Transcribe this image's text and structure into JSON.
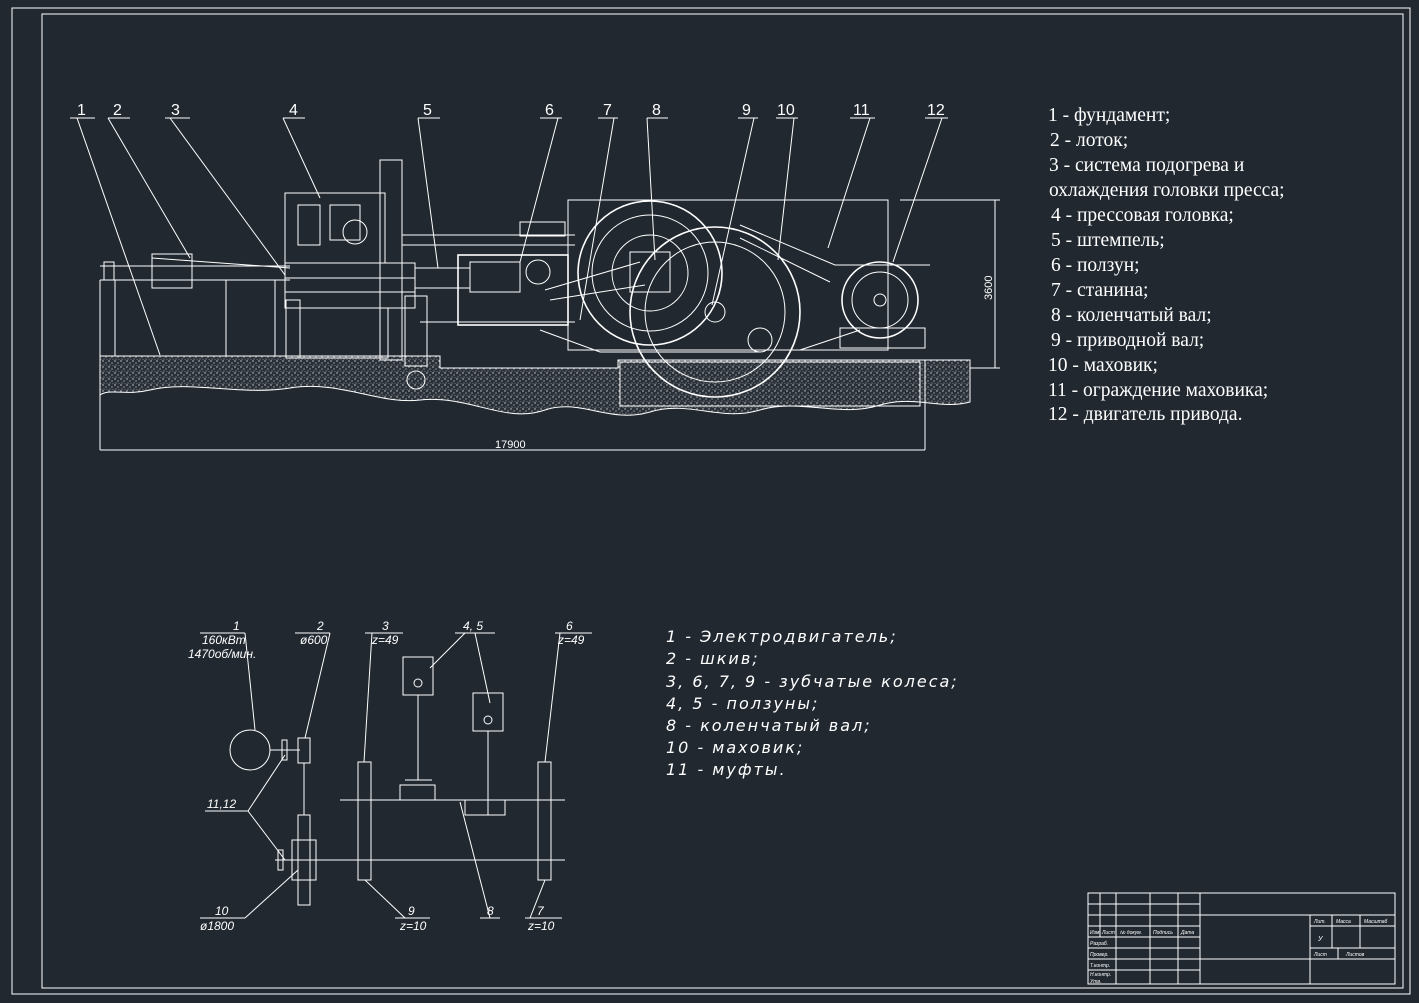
{
  "drawing": {
    "upper_view": {
      "callouts": [
        "1",
        "2",
        "3",
        "4",
        "5",
        "6",
        "7",
        "8",
        "9",
        "10",
        "11",
        "12"
      ],
      "dim_length": "17900",
      "dim_height": "3600",
      "legend": [
        "1 - фундамент;",
        "2 - лоток;",
        "3 - система подогрева и",
        "охлаждения головки пресса;",
        "4 - прессовая головка;",
        "5 - штемпель;",
        "6 - ползун;",
        "7 - станина;",
        "8 - коленчатый вал;",
        "9 - приводной вал;",
        "10 - маховик;",
        "11 - ограждение маховика;",
        "12 - двигатель привода."
      ]
    },
    "kinematic": {
      "label_1": "1",
      "label_1_power": "160кВт",
      "label_1_speed": "1470об/мин.",
      "label_2": "2",
      "label_2_dia": "ø600",
      "label_3": "3",
      "label_3_z": "z=49",
      "label_45": "4, 5",
      "label_6": "6",
      "label_6_z": "z=49",
      "label_1112": "11,12",
      "label_10": "10",
      "label_10_dia": "ø1800",
      "label_9": "9",
      "label_9_z": "z=10",
      "label_8": "8",
      "label_7": "7",
      "label_7_z": "z=10",
      "legend": [
        "1 - Электродвигатель;",
        "2 - шкив;",
        "3, 6, 7, 9 - зубчатые колеса;",
        "4, 5 -  ползуны;",
        "8 - коленчатый вал;",
        "10 - маховик;",
        "11 - муфты."
      ]
    },
    "title_block": {
      "h_izm": "Изм.",
      "h_list": "Лист",
      "h_doc": "№ докум.",
      "h_sign": "Подпись",
      "h_date": "Дата",
      "r_razrab": "Разраб.",
      "r_prov": "Провер.",
      "r_tkontr": "Т.контр.",
      "r_nkontr": "Н.контр.",
      "r_utv": "Утв.",
      "lit": "Лит.",
      "massa": "Масса",
      "masshtab": "Масштаб",
      "lit_val": "У",
      "list": "Лист",
      "listov": "Листов"
    }
  }
}
